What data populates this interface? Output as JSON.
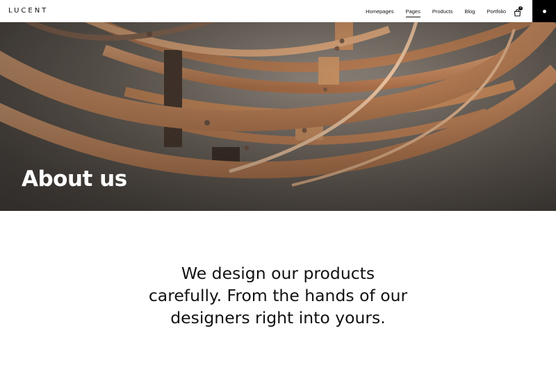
{
  "header": {
    "logo": "LUCENT",
    "nav": [
      {
        "label": "Homepages",
        "active": false
      },
      {
        "label": "Pages",
        "active": true
      },
      {
        "label": "Products",
        "active": false
      },
      {
        "label": "Blog",
        "active": false
      },
      {
        "label": "Portfolio",
        "active": false
      }
    ],
    "cart_icon": "shopping-bag-icon",
    "cart_count": "1",
    "menu_icon": "dot-menu-icon"
  },
  "hero": {
    "title": "About us",
    "image": "copper-ring-pendant-lamp"
  },
  "intro": {
    "lines": [
      "We design our products",
      "carefully. From the hands of our",
      "designers right into yours."
    ]
  },
  "colors": {
    "copper": "#c98d62",
    "copper_dark": "#8a5a3a",
    "background_gray": "#6d655d",
    "accent": "#000000"
  }
}
